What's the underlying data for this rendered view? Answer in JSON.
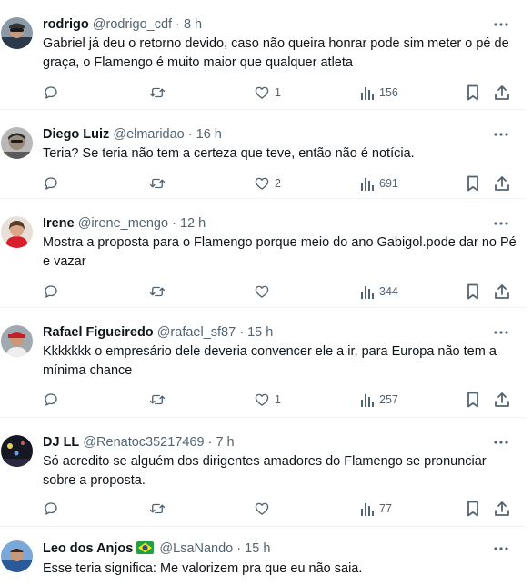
{
  "tweets": [
    {
      "name": "rodrigo",
      "handle": "@rodrigo_cdf",
      "time": "8 h",
      "text": "Gabriel já deu o retorno devido, caso não queira honrar pode sim meter o pé de graça, o Flamengo é muito maior que qualquer atleta",
      "replies": "",
      "retweets": "",
      "likes": "1",
      "views": "156"
    },
    {
      "name": "Diego Luiz",
      "handle": "@elmaridao",
      "time": "16 h",
      "text": "Teria? Se teria não tem a certeza que teve, então não é notícia.",
      "replies": "",
      "retweets": "",
      "likes": "2",
      "views": "691"
    },
    {
      "name": "Irene",
      "handle": "@irene_mengo",
      "time": "12 h",
      "text": "Mostra a proposta para o Flamengo porque meio do ano Gabigol.pode dar no Pé e vazar",
      "replies": "",
      "retweets": "",
      "likes": "",
      "views": "344"
    },
    {
      "name": "Rafael Figueiredo",
      "handle": "@rafael_sf87",
      "time": "15 h",
      "text": "Kkkkkkk o empresário dele deveria convencer ele a ir, para Europa não tem a mínima chance",
      "replies": "",
      "retweets": "",
      "likes": "1",
      "views": "257"
    },
    {
      "name": "DJ LL",
      "handle": "@Renatoc35217469",
      "time": "7 h",
      "text": "Só acredito se alguém dos dirigentes amadores do Flamengo se pronunciar sobre a proposta.",
      "replies": "",
      "retweets": "",
      "likes": "",
      "views": "77"
    },
    {
      "name": "Leo dos Anjos",
      "handle": "@LsaNando",
      "time": "15 h",
      "text": "Esse teria significa: Me valorizem pra que eu não saia.",
      "flag": "brazil-flag-emoji"
    }
  ],
  "separator": "·",
  "colors": {
    "text": "#0f1419",
    "secondary": "#536471",
    "divider": "#eff3f4",
    "background": "#ffffff"
  }
}
